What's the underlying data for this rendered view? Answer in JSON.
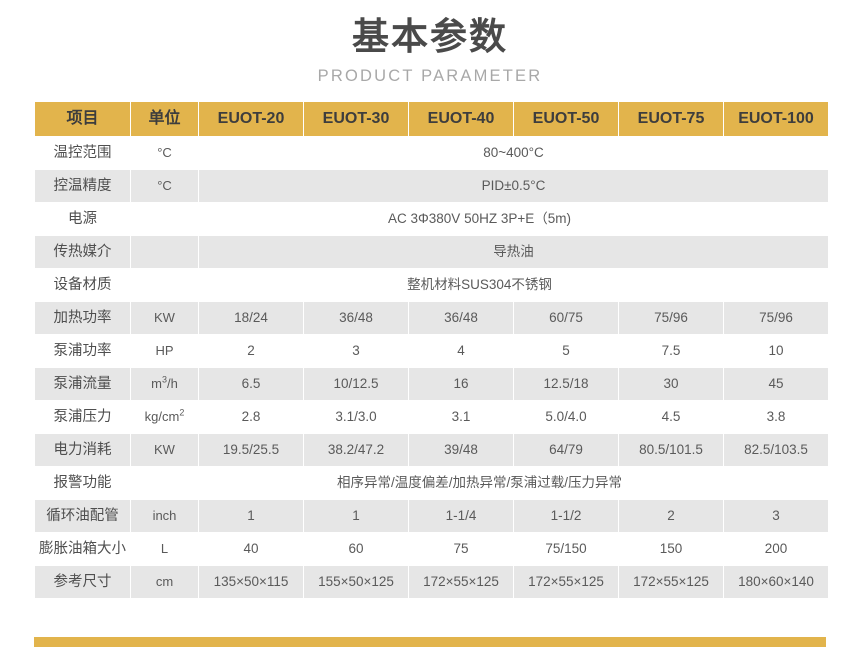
{
  "heading": {
    "title_cn": "基本参数",
    "title_en": "PRODUCT PARAMETER"
  },
  "colors": {
    "accent_gold": "#e2b44c",
    "row_stripe": "#e6e6e6",
    "row_plain": "#ffffff",
    "text": "#555555",
    "title": "#4a4a4a",
    "subtitle": "#a8a8a8"
  },
  "table": {
    "headers": [
      "项目",
      "单位",
      "EUOT-20",
      "EUOT-30",
      "EUOT-40",
      "EUOT-50",
      "EUOT-75",
      "EUOT-100"
    ],
    "rows": [
      {
        "label": "温控范围",
        "unit": "°C",
        "merged": true,
        "merged_value": "80~400°C",
        "values": []
      },
      {
        "label": "控温精度",
        "unit": "°C",
        "merged": true,
        "merged_value": "PID±0.5°C",
        "values": []
      },
      {
        "label": "电源",
        "unit": "",
        "merged": true,
        "merged_span_unit": true,
        "merged_value": "AC 3Φ380V 50HZ  3P+E（5m)",
        "values": []
      },
      {
        "label": "传热媒介",
        "unit": "",
        "merged": true,
        "merged_value": "导热油",
        "values": []
      },
      {
        "label": "设备材质",
        "unit": "",
        "merged": true,
        "merged_span_unit": true,
        "merged_value": "整机材料SUS304不锈钢",
        "values": []
      },
      {
        "label": "加热功率",
        "unit": "KW",
        "merged": false,
        "values": [
          "18/24",
          "36/48",
          "36/48",
          "60/75",
          "75/96",
          "75/96"
        ]
      },
      {
        "label": "泵浦功率",
        "unit": "HP",
        "merged": false,
        "values": [
          "2",
          "3",
          "4",
          "5",
          "7.5",
          "10"
        ]
      },
      {
        "label": "泵浦流量",
        "unit": "m³/h",
        "merged": false,
        "values": [
          "6.5",
          "10/12.5",
          "16",
          "12.5/18",
          "30",
          "45"
        ]
      },
      {
        "label": "泵浦压力",
        "unit": "kg/cm²",
        "merged": false,
        "values": [
          "2.8",
          "3.1/3.0",
          "3.1",
          "5.0/4.0",
          "4.5",
          "3.8"
        ]
      },
      {
        "label": "电力消耗",
        "unit": "KW",
        "merged": false,
        "values": [
          "19.5/25.5",
          "38.2/47.2",
          "39/48",
          "64/79",
          "80.5/101.5",
          "82.5/103.5"
        ]
      },
      {
        "label": "报警功能",
        "unit": "",
        "merged": true,
        "merged_span_unit": true,
        "merged_value": "相序异常/温度偏差/加热异常/泵浦过载/压力异常",
        "values": []
      },
      {
        "label": "循环油配管",
        "unit": "inch",
        "merged": false,
        "values": [
          "1",
          "1",
          "1-1/4",
          "1-1/2",
          "2",
          "3"
        ]
      },
      {
        "label": "膨胀油箱大小",
        "unit": "L",
        "merged": false,
        "values": [
          "40",
          "60",
          "75",
          "75/150",
          "150",
          "200"
        ]
      },
      {
        "label": "参考尺寸",
        "unit": "cm",
        "merged": false,
        "values": [
          "135×50×115",
          "155×50×125",
          "172×55×125",
          "172×55×125",
          "172×55×125",
          "180×60×140"
        ]
      }
    ]
  }
}
